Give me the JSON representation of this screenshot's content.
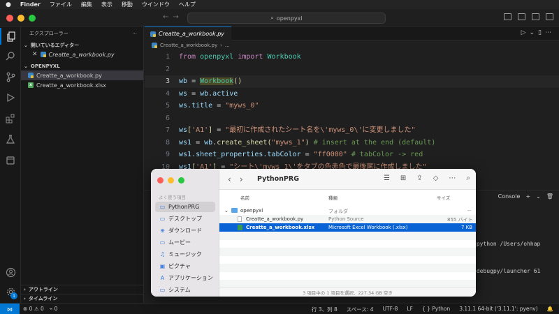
{
  "menubar": {
    "apple": "",
    "items": [
      "Finder",
      "ファイル",
      "編集",
      "表示",
      "移動",
      "ウインドウ",
      "ヘルプ"
    ]
  },
  "titlebar": {
    "command_center": "openpyxl",
    "window_dots": [
      "#ff5f57",
      "#febc2e",
      "#28c840"
    ]
  },
  "sidebar": {
    "header": "エクスプローラー",
    "header_more": "···",
    "open_editors_label": "開いているエディター",
    "open_editors": [
      {
        "label": "Creatte_a_workbook.py"
      }
    ],
    "folder_label": "OPENPYXL",
    "files": [
      {
        "label": "Creatte_a_workbook.py",
        "icon": "python-file-icon"
      },
      {
        "label": "Creatte_a_workbook.xlsx",
        "icon": "excel-file-icon"
      }
    ],
    "outline_label": "アウトライン",
    "timeline_label": "タイムライン"
  },
  "activity": {
    "notifications_badge": "1"
  },
  "editor": {
    "tab_label": "Creatte_a_workbook.py",
    "breadcrumb_file": "Creatte_a_workbook.py",
    "breadcrumb_more": "...",
    "line_numbers": [
      "1",
      "2",
      "3",
      "4",
      "5",
      "6",
      "7",
      "8",
      "9",
      "10",
      "11"
    ],
    "code": {
      "l1_from": "from",
      "l1_mod": "openpyxl",
      "l1_import": "import",
      "l1_cls": "Workbook",
      "l3_var": "wb",
      "l3_eq": " = ",
      "l3_cls": "Workbook",
      "l3_paren": "()",
      "l4_var": "ws",
      "l4_rest": " = ",
      "l4_obj": "wb",
      "l4_attr": ".active",
      "l5_obj": "ws",
      "l5_attr": ".title",
      "l5_eq": " = ",
      "l5_str": "\"myws_0\"",
      "l7_var": "ws",
      "l7_br": "[",
      "l7_key": "'A1'",
      "l7_br2": "]",
      "l7_eq": " = ",
      "l7_str": "\"最初に作成されたシート名を\\'myws_0\\'に変更しました\"",
      "l8_var": "ws1",
      "l8_eq": " = ",
      "l8_obj": "wb",
      "l8_dot": ".",
      "l8_fn": "create_sheet",
      "l8_p1": "(",
      "l8_str": "\"myws_1\"",
      "l8_p2": ")",
      "l8_com": " # insert at the end (default)",
      "l9_obj": "ws1",
      "l9_attr": ".sheet_properties.tabColor",
      "l9_eq": " = ",
      "l9_str": "\"ff0000\"",
      "l9_com": " # tabColor -> red",
      "l10_var": "ws1",
      "l10_br": "[",
      "l10_key": "'A1'",
      "l10_br2": "]",
      "l10_eq": " = ",
      "l10_str": "\"シート\\'myws_1\\'をタブの色赤色で最後尾に作成しました\""
    }
  },
  "panel": {
    "console_label": "Console",
    "term_lines": [
      "/python /Users/ohhap",
      "/debugpy/launcher 61"
    ]
  },
  "statusbar": {
    "errors": "0",
    "warnings": "0",
    "ports": "0",
    "position": "行 3、列 8",
    "spaces": "スペース: 4",
    "encoding": "UTF-8",
    "eol": "LF",
    "language": "Python",
    "interpreter": "3.11.1 64-bit ('3.11.1': pyenv)"
  },
  "finder": {
    "title": "PythonPRG",
    "favorites_label": "よく使う項目",
    "sidebar_items": [
      {
        "label": "PythonPRG",
        "icon": "folder-icon"
      },
      {
        "label": "デスクトップ",
        "icon": "desktop-icon"
      },
      {
        "label": "ダウンロード",
        "icon": "download-icon"
      },
      {
        "label": "ムービー",
        "icon": "movie-icon"
      },
      {
        "label": "ミュージック",
        "icon": "music-icon"
      },
      {
        "label": "ピクチャ",
        "icon": "picture-icon"
      },
      {
        "label": "アプリケーション",
        "icon": "applications-icon"
      },
      {
        "label": "システム",
        "icon": "system-folder-icon"
      }
    ],
    "columns": {
      "name": "名前",
      "kind": "種類",
      "size": "サイズ"
    },
    "rows": [
      {
        "name": "openpyxl",
        "kind": "フォルダ",
        "size": "--"
      },
      {
        "name": "Creatte_a_workbook.py",
        "kind": "Python Source",
        "size": "855 バイト"
      },
      {
        "name": "Creatte_a_workbook.xlsx",
        "kind": "Microsoft Excel Workbook (.xlsx)",
        "size": "7 KB"
      }
    ],
    "status": "3 項目中の 1 項目を選択、227.34 GB 空き"
  }
}
